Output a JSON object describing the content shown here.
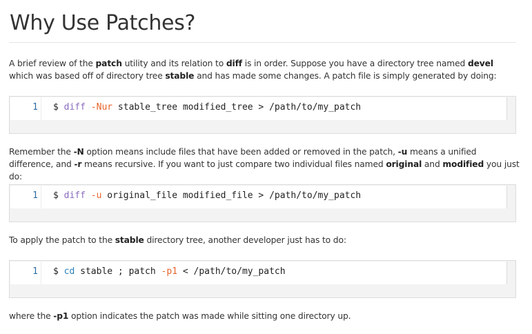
{
  "title": "Why Use Patches?",
  "para1": {
    "t1": "A brief review of the ",
    "b1": "patch",
    "t2": " utility and its relation to ",
    "b2": "diff",
    "t3": " is in order. Suppose you have a directory tree named ",
    "b3": "devel",
    "t4": " which was based off of directory tree ",
    "b4": "stable",
    "t5": " and has made some changes. A patch file is simply generated by doing:"
  },
  "code1": {
    "line_number": "1",
    "prompt": "$ ",
    "cmd": "diff",
    "sp1": " ",
    "opt": "-Nur",
    "rest": " stable_tree modified_tree > /path/to/my_patch"
  },
  "para2": {
    "t1": "Remember the ",
    "b1": "-N",
    "t2": " option means include files that have been added or removed in the patch, ",
    "b2": "-u",
    "t3": " means a unified difference, and ",
    "b3": "-r",
    "t4": " means recursive. If you want to just compare two individual files named ",
    "b4": "original",
    "t5": " and ",
    "b5": "modified",
    "t6": " you just do:"
  },
  "code2": {
    "line_number": "1",
    "prompt": "$ ",
    "cmd": "diff",
    "sp1": " ",
    "opt": "-u",
    "rest": " original_file modified_file > /path/to/my_patch"
  },
  "para3": {
    "t1": "To apply the patch to the ",
    "b1": "stable",
    "t2": " directory tree, another developer just has to do:"
  },
  "code3": {
    "line_number": "1",
    "prompt": "$ ",
    "cmd": "cd",
    "mid": " stable ; patch ",
    "opt": "-p1",
    "rest": " < /path/to/my_patch"
  },
  "para4": {
    "t1": "where the ",
    "b1": "-p1",
    "t2": " option indicates the patch was made while sitting one directory up."
  },
  "colors": {
    "command": "#8a6bbf",
    "option": "#e8632b",
    "cd_command": "#2a80b9",
    "line_number": "#2d6ca2"
  }
}
